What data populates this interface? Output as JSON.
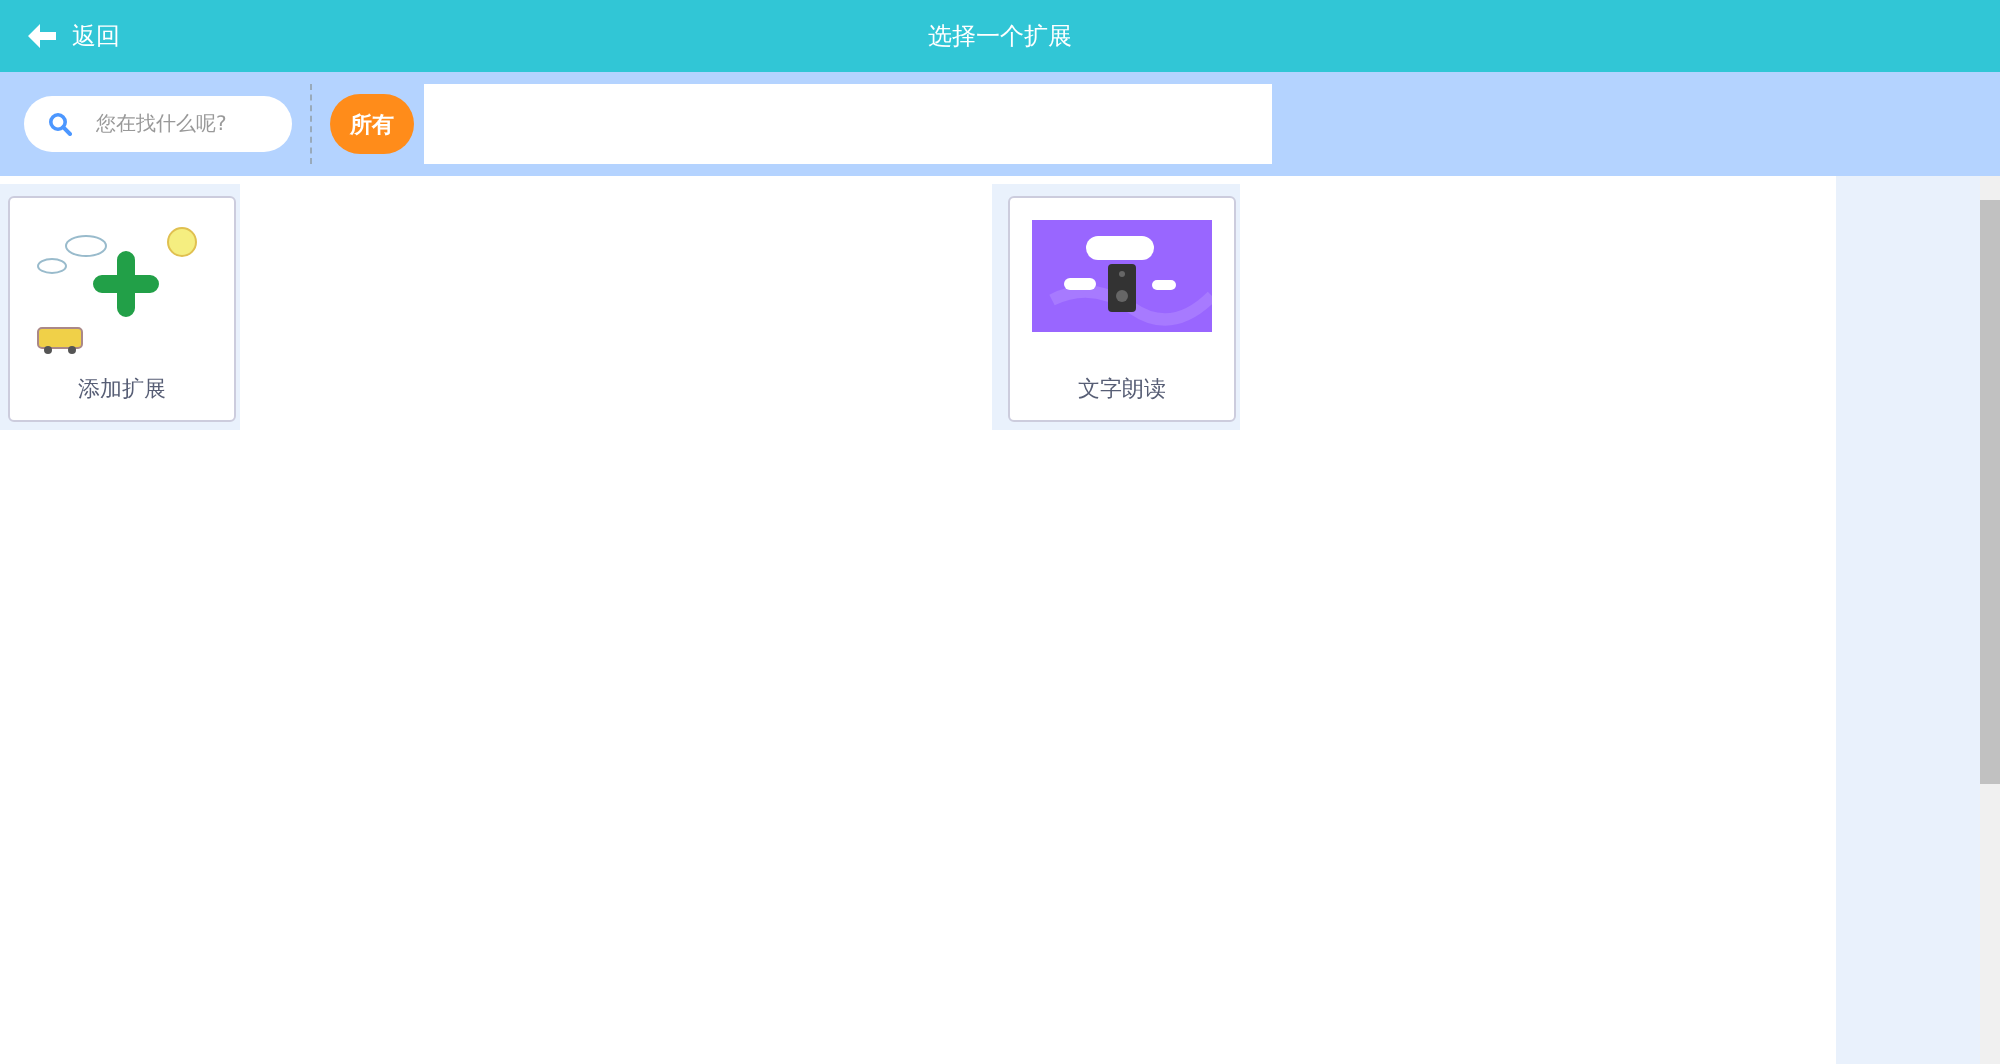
{
  "header": {
    "back_label": "返回",
    "title": "选择一个扩展"
  },
  "toolbar": {
    "search": {
      "placeholder": "您在找什么呢?"
    },
    "tags": [
      {
        "label": "所有",
        "selected": true
      }
    ]
  },
  "extensions": [
    {
      "kind": "add",
      "name": "添加扩展"
    },
    {
      "kind": "speech",
      "name": "文字朗读"
    }
  ]
}
